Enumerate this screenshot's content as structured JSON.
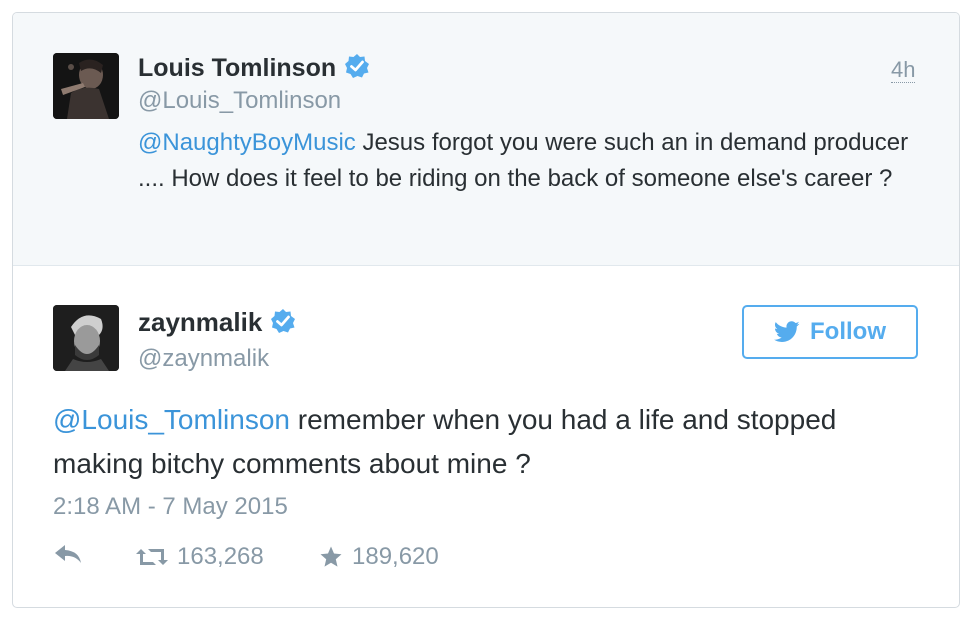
{
  "parent_tweet": {
    "author_name": "Louis Tomlinson",
    "author_handle": "@Louis_Tomlinson",
    "time": "4h",
    "mention": "@NaughtyBoyMusic",
    "text": " Jesus forgot you were such an in demand producer .... How does it feel to be riding on the back of someone else's career ?"
  },
  "main_tweet": {
    "author_name": "zaynmalik",
    "author_handle": "@zaynmalik",
    "follow_label": "Follow",
    "mention": "@Louis_Tomlinson",
    "text": " remember when you had a life and stopped making bitchy comments about mine ?",
    "date": "2:18 AM - 7 May 2015",
    "retweets": "163,268",
    "favorites": "189,620"
  },
  "icons": [
    "verified-badge-icon",
    "bird-icon",
    "reply-icon",
    "retweet-icon",
    "star-icon"
  ],
  "colors": {
    "accent": "#55acee",
    "mention": "#3b94d9",
    "text": "#292f33",
    "muted": "#8899a6",
    "parent_background": "#f5f8fa"
  }
}
